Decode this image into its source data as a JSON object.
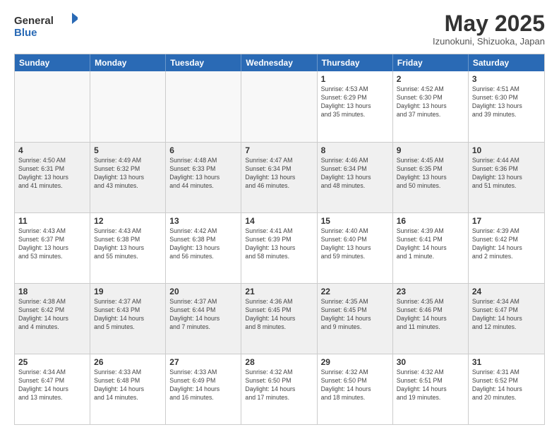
{
  "header": {
    "logo_general": "General",
    "logo_blue": "Blue",
    "month_title": "May 2025",
    "subtitle": "Izunokuni, Shizuoka, Japan"
  },
  "calendar": {
    "weekdays": [
      "Sunday",
      "Monday",
      "Tuesday",
      "Wednesday",
      "Thursday",
      "Friday",
      "Saturday"
    ],
    "rows": [
      [
        {
          "day": "",
          "info": "",
          "empty": true
        },
        {
          "day": "",
          "info": "",
          "empty": true
        },
        {
          "day": "",
          "info": "",
          "empty": true
        },
        {
          "day": "",
          "info": "",
          "empty": true
        },
        {
          "day": "1",
          "info": "Sunrise: 4:53 AM\nSunset: 6:29 PM\nDaylight: 13 hours\nand 35 minutes.",
          "empty": false
        },
        {
          "day": "2",
          "info": "Sunrise: 4:52 AM\nSunset: 6:30 PM\nDaylight: 13 hours\nand 37 minutes.",
          "empty": false
        },
        {
          "day": "3",
          "info": "Sunrise: 4:51 AM\nSunset: 6:30 PM\nDaylight: 13 hours\nand 39 minutes.",
          "empty": false
        }
      ],
      [
        {
          "day": "4",
          "info": "Sunrise: 4:50 AM\nSunset: 6:31 PM\nDaylight: 13 hours\nand 41 minutes.",
          "empty": false
        },
        {
          "day": "5",
          "info": "Sunrise: 4:49 AM\nSunset: 6:32 PM\nDaylight: 13 hours\nand 43 minutes.",
          "empty": false
        },
        {
          "day": "6",
          "info": "Sunrise: 4:48 AM\nSunset: 6:33 PM\nDaylight: 13 hours\nand 44 minutes.",
          "empty": false
        },
        {
          "day": "7",
          "info": "Sunrise: 4:47 AM\nSunset: 6:34 PM\nDaylight: 13 hours\nand 46 minutes.",
          "empty": false
        },
        {
          "day": "8",
          "info": "Sunrise: 4:46 AM\nSunset: 6:34 PM\nDaylight: 13 hours\nand 48 minutes.",
          "empty": false
        },
        {
          "day": "9",
          "info": "Sunrise: 4:45 AM\nSunset: 6:35 PM\nDaylight: 13 hours\nand 50 minutes.",
          "empty": false
        },
        {
          "day": "10",
          "info": "Sunrise: 4:44 AM\nSunset: 6:36 PM\nDaylight: 13 hours\nand 51 minutes.",
          "empty": false
        }
      ],
      [
        {
          "day": "11",
          "info": "Sunrise: 4:43 AM\nSunset: 6:37 PM\nDaylight: 13 hours\nand 53 minutes.",
          "empty": false
        },
        {
          "day": "12",
          "info": "Sunrise: 4:43 AM\nSunset: 6:38 PM\nDaylight: 13 hours\nand 55 minutes.",
          "empty": false
        },
        {
          "day": "13",
          "info": "Sunrise: 4:42 AM\nSunset: 6:38 PM\nDaylight: 13 hours\nand 56 minutes.",
          "empty": false
        },
        {
          "day": "14",
          "info": "Sunrise: 4:41 AM\nSunset: 6:39 PM\nDaylight: 13 hours\nand 58 minutes.",
          "empty": false
        },
        {
          "day": "15",
          "info": "Sunrise: 4:40 AM\nSunset: 6:40 PM\nDaylight: 13 hours\nand 59 minutes.",
          "empty": false
        },
        {
          "day": "16",
          "info": "Sunrise: 4:39 AM\nSunset: 6:41 PM\nDaylight: 14 hours\nand 1 minute.",
          "empty": false
        },
        {
          "day": "17",
          "info": "Sunrise: 4:39 AM\nSunset: 6:42 PM\nDaylight: 14 hours\nand 2 minutes.",
          "empty": false
        }
      ],
      [
        {
          "day": "18",
          "info": "Sunrise: 4:38 AM\nSunset: 6:42 PM\nDaylight: 14 hours\nand 4 minutes.",
          "empty": false
        },
        {
          "day": "19",
          "info": "Sunrise: 4:37 AM\nSunset: 6:43 PM\nDaylight: 14 hours\nand 5 minutes.",
          "empty": false
        },
        {
          "day": "20",
          "info": "Sunrise: 4:37 AM\nSunset: 6:44 PM\nDaylight: 14 hours\nand 7 minutes.",
          "empty": false
        },
        {
          "day": "21",
          "info": "Sunrise: 4:36 AM\nSunset: 6:45 PM\nDaylight: 14 hours\nand 8 minutes.",
          "empty": false
        },
        {
          "day": "22",
          "info": "Sunrise: 4:35 AM\nSunset: 6:45 PM\nDaylight: 14 hours\nand 9 minutes.",
          "empty": false
        },
        {
          "day": "23",
          "info": "Sunrise: 4:35 AM\nSunset: 6:46 PM\nDaylight: 14 hours\nand 11 minutes.",
          "empty": false
        },
        {
          "day": "24",
          "info": "Sunrise: 4:34 AM\nSunset: 6:47 PM\nDaylight: 14 hours\nand 12 minutes.",
          "empty": false
        }
      ],
      [
        {
          "day": "25",
          "info": "Sunrise: 4:34 AM\nSunset: 6:47 PM\nDaylight: 14 hours\nand 13 minutes.",
          "empty": false
        },
        {
          "day": "26",
          "info": "Sunrise: 4:33 AM\nSunset: 6:48 PM\nDaylight: 14 hours\nand 14 minutes.",
          "empty": false
        },
        {
          "day": "27",
          "info": "Sunrise: 4:33 AM\nSunset: 6:49 PM\nDaylight: 14 hours\nand 16 minutes.",
          "empty": false
        },
        {
          "day": "28",
          "info": "Sunrise: 4:32 AM\nSunset: 6:50 PM\nDaylight: 14 hours\nand 17 minutes.",
          "empty": false
        },
        {
          "day": "29",
          "info": "Sunrise: 4:32 AM\nSunset: 6:50 PM\nDaylight: 14 hours\nand 18 minutes.",
          "empty": false
        },
        {
          "day": "30",
          "info": "Sunrise: 4:32 AM\nSunset: 6:51 PM\nDaylight: 14 hours\nand 19 minutes.",
          "empty": false
        },
        {
          "day": "31",
          "info": "Sunrise: 4:31 AM\nSunset: 6:52 PM\nDaylight: 14 hours\nand 20 minutes.",
          "empty": false
        }
      ]
    ]
  }
}
